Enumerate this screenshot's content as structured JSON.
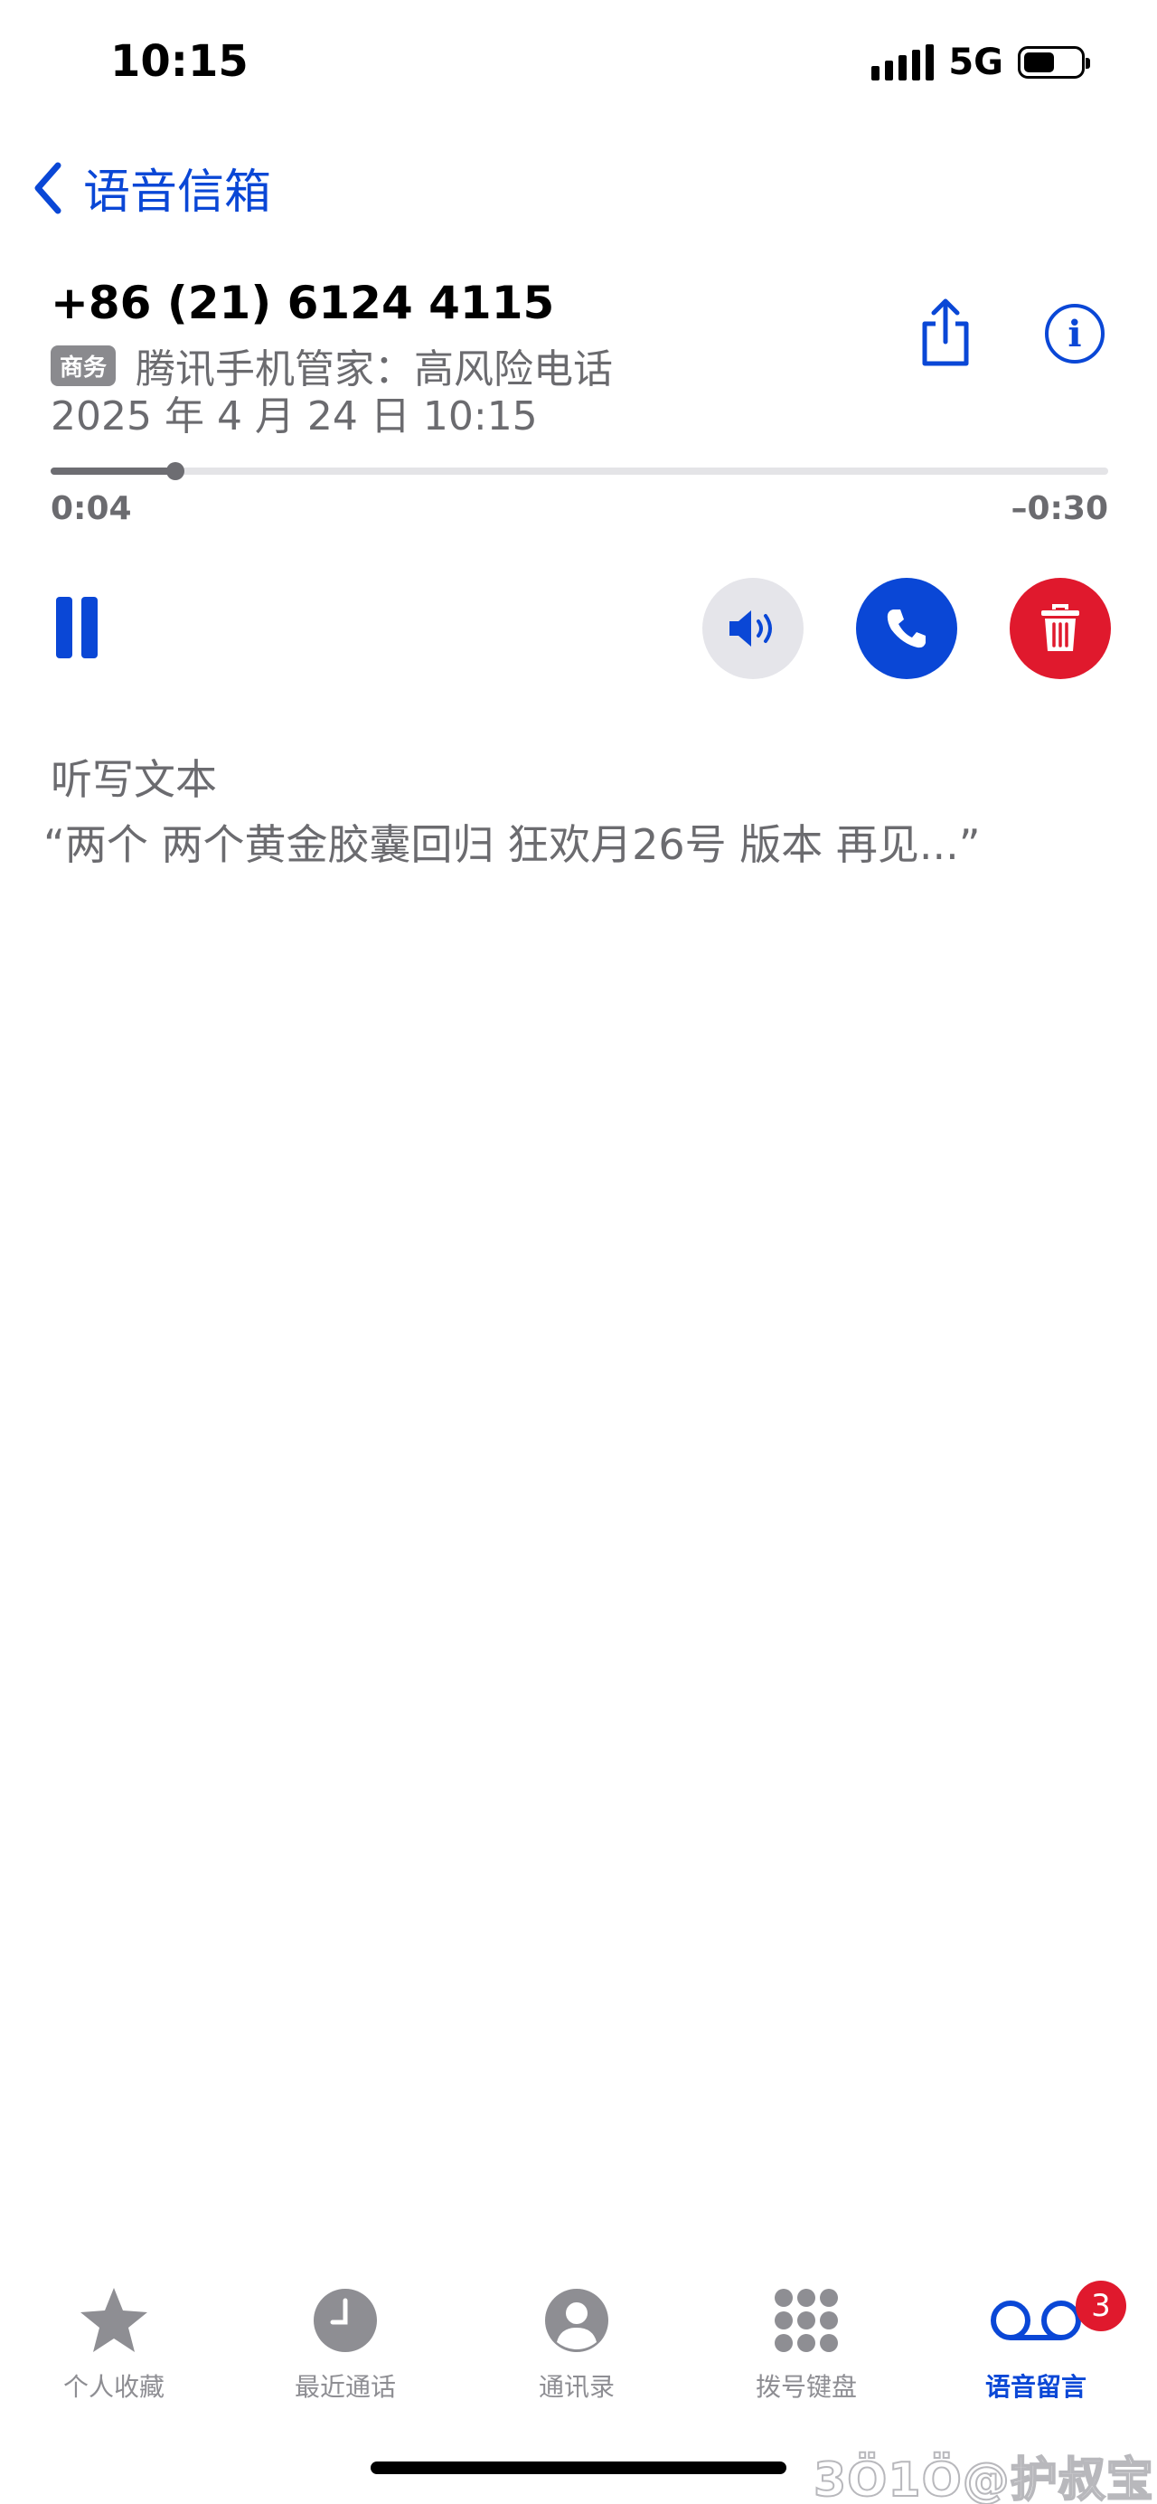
{
  "status_bar": {
    "time": "10:15",
    "network": "5G",
    "battery_level": 0.55
  },
  "nav": {
    "back_label": "语音信箱"
  },
  "voicemail": {
    "number": "+86 (21) 6124 4115",
    "tag_badge": "商务",
    "tag_text": "腾讯手机管家：高风险电话",
    "date": "2025 年 4 月 24 日 10:15",
    "progress_fraction": 0.118,
    "elapsed": "0:04",
    "remaining": "–0:30"
  },
  "transcript": {
    "title": "听写文本",
    "text": "“两个 两个黄金胶囊回归 狂欢月26号 版本 再见...”"
  },
  "tabs": [
    {
      "label": "个人收藏",
      "icon": "star-icon",
      "active": false
    },
    {
      "label": "最近通话",
      "icon": "clock-icon",
      "active": false
    },
    {
      "label": "通讯录",
      "icon": "contact-icon",
      "active": false
    },
    {
      "label": "拨号键盘",
      "icon": "keypad-icon",
      "active": false
    },
    {
      "label": "语音留言",
      "icon": "voicemail-icon",
      "active": true
    }
  ],
  "voicemail_badge": "3",
  "watermark": "3Ö1Ö@护叔宝",
  "colors": {
    "accent": "#0a47d6",
    "delete": "#e0192d",
    "secondary_text": "#6b6b6f",
    "tab_inactive": "#8e8e93"
  }
}
